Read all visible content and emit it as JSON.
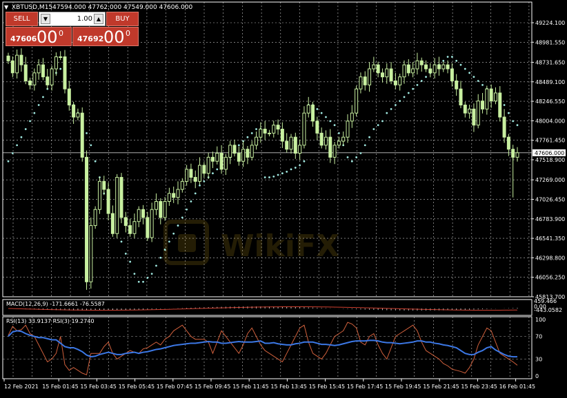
{
  "symbol_header": {
    "arrow": "▼",
    "symbol": "XBTUSD,M15",
    "ohlc": "47594.000 47762.000 47549.000 47606.000"
  },
  "trade_panel": {
    "sell_label": "SELL",
    "buy_label": "BUY",
    "lot_value": "1.00",
    "dec_icon": "▼",
    "inc_icon": "▲",
    "sell_price_small": "47606",
    "sell_price_big": "00",
    "sell_price_sup": "0",
    "buy_price_small": "47692",
    "buy_price_big": "00",
    "buy_price_sup": "0"
  },
  "price_axis": {
    "ticks": [
      "49224.100",
      "48981.550",
      "48731.650",
      "48489.100",
      "48246.550",
      "48004.000",
      "47761.450",
      "47518.900",
      "47269.000",
      "47026.450",
      "46783.900",
      "46541.350",
      "46298.800",
      "46056.250",
      "45813.700"
    ],
    "current_price": "47606.000"
  },
  "macd": {
    "label": "MACD(12,26,9) -171.6661 -76.5587",
    "ticks": [
      "459.466",
      "0.00",
      "-443.0582"
    ]
  },
  "rsi": {
    "label": "RSI(13) 33.9137  RSI(3) 19.2740",
    "ticks": [
      "100",
      "70",
      "30",
      "0"
    ]
  },
  "time_axis": {
    "labels": [
      "12 Feb 2021",
      "15 Feb 01:45",
      "15 Feb 03:45",
      "15 Feb 05:45",
      "15 Feb 07:45",
      "15 Feb 09:45",
      "15 Feb 11:45",
      "15 Feb 13:45",
      "15 Feb 15:45",
      "15 Feb 17:45",
      "15 Feb 19:45",
      "15 Feb 21:45",
      "15 Feb 23:45",
      "16 Feb 01:45"
    ]
  },
  "colors": {
    "background": "#000000",
    "grid": "#c8c8c8",
    "candle": "#c8f0a0",
    "candle_outline": "#7fb35a",
    "sar": "#a0e8e0",
    "rsi13": "#3c78e6",
    "rsi3": "#d0603c",
    "macd": "#c8c8c8",
    "macd_signal": "#d04030",
    "panel_red": "#c0392b"
  },
  "chart_data": {
    "type": "candlestick",
    "closes": [
      48750,
      48600,
      48820,
      48700,
      48500,
      48450,
      48600,
      48700,
      48550,
      48450,
      48650,
      48800,
      48800,
      48400,
      48200,
      48050,
      48100,
      47550,
      46000,
      46700,
      46900,
      47250,
      47150,
      46850,
      46600,
      47300,
      46800,
      46700,
      46600,
      46750,
      46900,
      46800,
      46550,
      46900,
      47000,
      46800,
      47000,
      47100,
      47050,
      47150,
      47250,
      47400,
      47300,
      47250,
      47450,
      47350,
      47550,
      47500,
      47600,
      47400,
      47550,
      47700,
      47600,
      47500,
      47650,
      47550,
      47700,
      47800,
      47900,
      47850,
      47850,
      47950,
      47900,
      47750,
      47650,
      47800,
      47600,
      47700,
      48100,
      48200,
      48000,
      47850,
      47700,
      47800,
      47550,
      47700,
      47750,
      47800,
      48000,
      48100,
      48400,
      48550,
      48450,
      48650,
      48700,
      48600,
      48550,
      48650,
      48500,
      48450,
      48550,
      48700,
      48600,
      48650,
      48750,
      48700,
      48650,
      48600,
      48700,
      48650,
      48700,
      48650,
      48500,
      48400,
      48200,
      48100,
      48150,
      47950,
      48250,
      48150,
      48400,
      48250,
      48350,
      48050,
      47800,
      47650,
      47550,
      47606
    ],
    "sar": [
      47500,
      47600,
      47700,
      47800,
      47900,
      48000,
      48100,
      48200,
      48300,
      48400,
      48500,
      48600,
      48650,
      48700,
      48300,
      48200,
      48100,
      48000,
      47850,
      47700,
      47500,
      47300,
      47100,
      46950,
      46800,
      46650,
      46500,
      46350,
      46250,
      46100,
      46000,
      46000,
      46050,
      46100,
      46200,
      46300,
      46400,
      46500,
      46600,
      46700,
      46800,
      46900,
      47000,
      47100,
      47200,
      47250,
      47300,
      47350,
      47400,
      47450,
      47500,
      47550,
      47650,
      47700,
      47750,
      47800,
      47850,
      47900,
      47900,
      47300,
      47300,
      47310,
      47330,
      47350,
      47370,
      47400,
      47420,
      47450,
      47500,
      48200,
      48200,
      48150,
      48100,
      48050,
      48000,
      47950,
      47850,
      47700,
      47550,
      47500,
      47550,
      47600,
      47700,
      47800,
      47900,
      47950,
      48000,
      48100,
      48150,
      48200,
      48250,
      48300,
      48350,
      48400,
      48450,
      48500,
      48550,
      48600,
      48650,
      48700,
      48750,
      48800,
      48800,
      48750,
      48700,
      48650,
      48600,
      48550,
      48500,
      48450,
      48400,
      48350,
      48300,
      48250,
      48200,
      48100,
      48000,
      47950
    ],
    "rsi13": [
      70,
      78,
      80,
      79,
      75,
      72,
      70,
      68,
      68,
      66,
      64,
      64,
      58,
      52,
      50,
      50,
      47,
      43,
      37,
      34,
      35,
      38,
      40,
      42,
      40,
      38,
      38,
      40,
      41,
      42,
      40,
      42,
      43,
      45,
      47,
      48,
      50,
      52,
      54,
      55,
      56,
      57,
      58,
      58,
      59,
      60,
      61,
      60,
      60,
      58,
      58,
      59,
      60,
      61,
      60,
      60,
      60,
      61,
      62,
      58,
      58,
      59,
      57,
      56,
      55,
      55,
      57,
      58,
      60,
      60,
      60,
      58,
      56,
      56,
      55,
      54,
      55,
      57,
      59,
      61,
      62,
      62,
      62,
      63,
      63,
      62,
      60,
      59,
      59,
      58,
      57,
      58,
      59,
      60,
      62,
      62,
      60,
      60,
      58,
      57,
      55,
      54,
      52,
      50,
      45,
      40,
      38,
      38,
      42,
      45,
      50,
      52,
      46,
      42,
      38,
      35,
      34,
      34
    ],
    "rsi3": [
      72,
      88,
      80,
      82,
      90,
      75,
      70,
      55,
      40,
      25,
      30,
      40,
      70,
      20,
      10,
      15,
      10,
      5,
      2,
      40,
      40,
      40,
      52,
      60,
      40,
      30,
      35,
      40,
      45,
      42,
      40,
      48,
      50,
      55,
      60,
      55,
      65,
      70,
      80,
      85,
      90,
      80,
      70,
      65,
      65,
      65,
      60,
      40,
      60,
      80,
      70,
      60,
      50,
      40,
      55,
      75,
      85,
      70,
      55,
      45,
      40,
      35,
      30,
      25,
      40,
      55,
      70,
      85,
      90,
      60,
      40,
      35,
      30,
      40,
      55,
      70,
      75,
      80,
      95,
      92,
      85,
      60,
      55,
      70,
      75,
      55,
      40,
      30,
      50,
      70,
      75,
      80,
      85,
      90,
      80,
      60,
      45,
      40,
      35,
      30,
      22,
      18,
      12,
      10,
      8,
      5,
      15,
      30,
      55,
      70,
      85,
      80,
      60,
      40,
      35,
      30,
      25,
      19
    ]
  }
}
